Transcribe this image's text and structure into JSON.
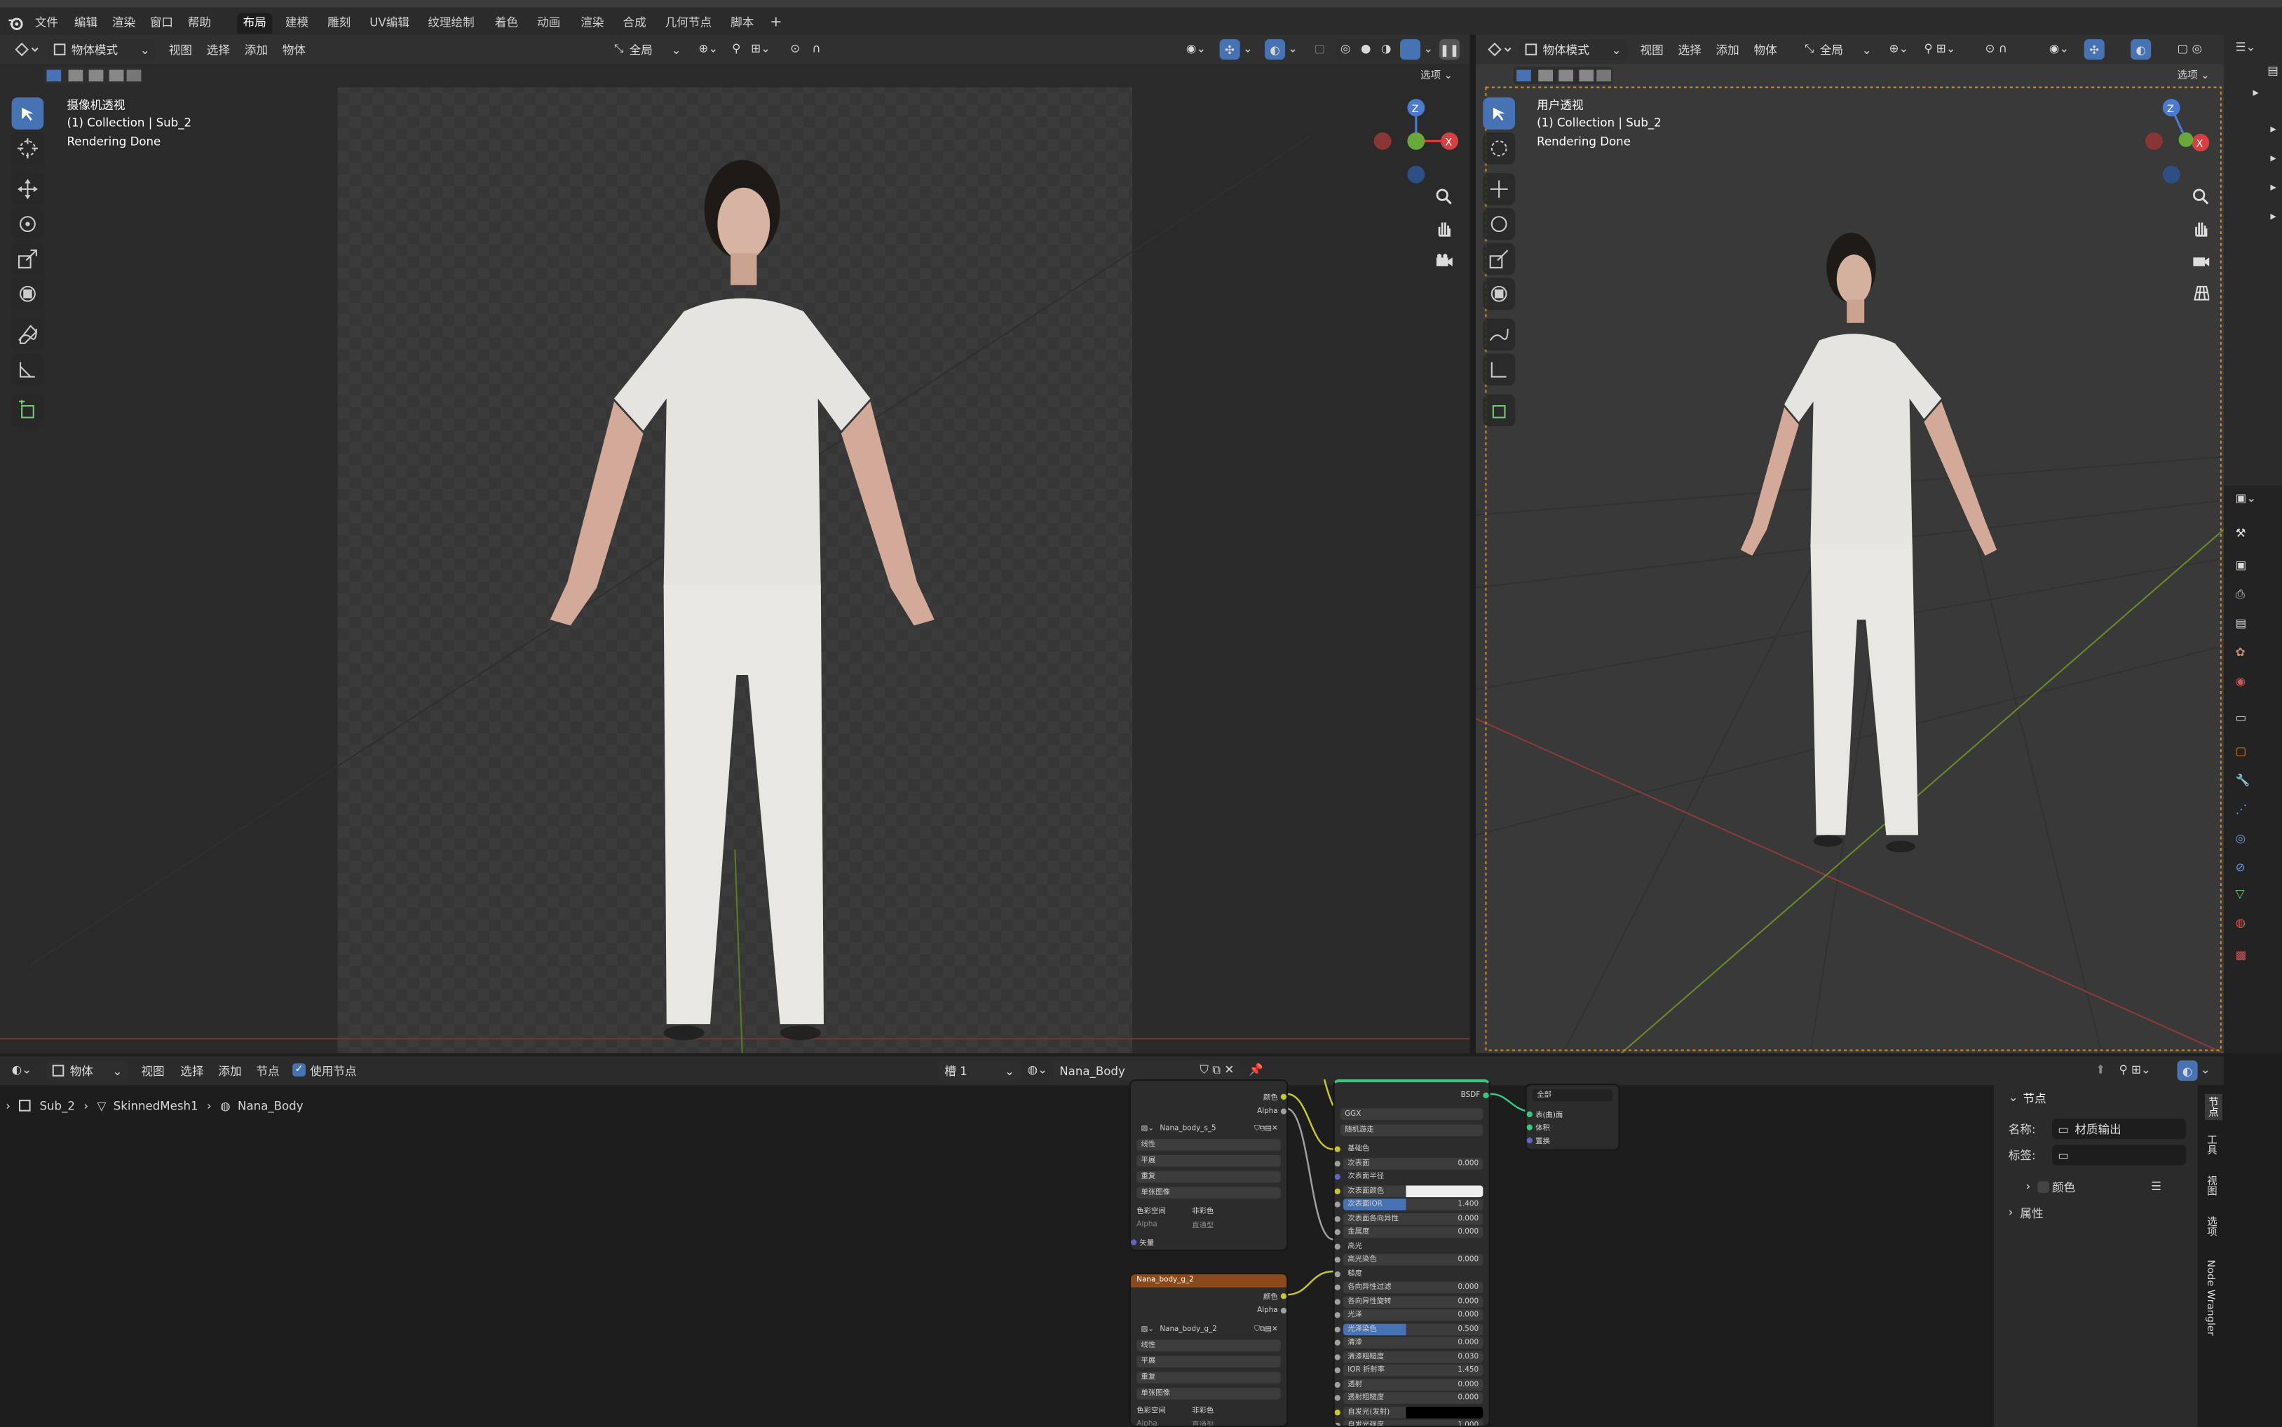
{
  "menu": {
    "file": "文件",
    "edit": "编辑",
    "render": "渲染",
    "window": "窗口",
    "help": "帮助"
  },
  "workspaces": [
    "布局",
    "建模",
    "雕刻",
    "UV编辑",
    "纹理绘制",
    "着色",
    "动画",
    "渲染",
    "合成",
    "几何节点",
    "脚本"
  ],
  "add_workspace": "+",
  "left_viewport": {
    "mode": "物体模式",
    "menus": [
      "视图",
      "选择",
      "添加",
      "物体"
    ],
    "transform": "全局",
    "options": "选项",
    "view_name": "摄像机透视",
    "collection": "(1) Collection | Sub_2",
    "status": "Rendering Done"
  },
  "right_viewport": {
    "mode": "物体模式",
    "menus": [
      "视图",
      "选择",
      "添加",
      "物体"
    ],
    "transform": "全局",
    "options": "选项",
    "view_name": "用户透视",
    "collection": "(1) Collection | Sub_2",
    "status": "Rendering Done"
  },
  "gizmo": {
    "z": "Z",
    "x": "X"
  },
  "node_editor": {
    "type": "物体",
    "menus": [
      "视图",
      "选择",
      "添加",
      "节点"
    ],
    "use_nodes_label": "使用节点",
    "use_nodes": true,
    "slot": "槽 1",
    "material": "Nana_Body",
    "breadcrumb": [
      "Sub_2",
      "SkinnedMesh1",
      "Nana_Body"
    ]
  },
  "nodes": {
    "image1": {
      "out_color": "颜色",
      "out_alpha": "Alpha",
      "image": "Nana_body_s_5",
      "rows": [
        "线性",
        "平展",
        "重复",
        "单张图像"
      ],
      "colorspace_label": "色彩空间",
      "colorspace": "非彩色",
      "alpha_label": "Alpha",
      "alpha_mode": "直通型",
      "vector": "矢量"
    },
    "image2": {
      "title": "Nana_body_g_2",
      "out_color": "颜色",
      "out_alpha": "Alpha",
      "image": "Nana_body_g_2",
      "rows": [
        "线性",
        "平展",
        "重复",
        "单张图像"
      ],
      "colorspace_label": "色彩空间",
      "colorspace": "非彩色",
      "alpha_label": "Alpha",
      "alpha_mode": "直通型"
    },
    "bsdf": {
      "title": "BSDF",
      "dist": "GGX",
      "subsurface_method": "随机游走",
      "rows": [
        {
          "label": "基础色",
          "value": ""
        },
        {
          "label": "次表面",
          "value": "0.000"
        },
        {
          "label": "次表面半径",
          "value": ""
        },
        {
          "label": "次表面颜色",
          "value": ""
        },
        {
          "label": "次表面IOR",
          "value": "1.400"
        },
        {
          "label": "次表面各向异性",
          "value": "0.000"
        },
        {
          "label": "金属度",
          "value": "0.000"
        },
        {
          "label": "高光",
          "value": ""
        },
        {
          "label": "高光染色",
          "value": "0.000"
        },
        {
          "label": "糙度",
          "value": ""
        },
        {
          "label": "各向异性过滤",
          "value": "0.000"
        },
        {
          "label": "各向异性旋转",
          "value": "0.000"
        },
        {
          "label": "光泽",
          "value": "0.000"
        },
        {
          "label": "光泽染色",
          "value": "0.500"
        },
        {
          "label": "清漆",
          "value": "0.000"
        },
        {
          "label": "清漆粗糙度",
          "value": "0.030"
        },
        {
          "label": "IOR 折射率",
          "value": "1.450"
        },
        {
          "label": "透射",
          "value": "0.000"
        },
        {
          "label": "透射粗糙度",
          "value": "0.000"
        },
        {
          "label": "自发光(发射)",
          "value": ""
        },
        {
          "label": "自发光强度",
          "value": "1.000"
        }
      ]
    },
    "output": {
      "target": "全部",
      "rows": [
        "表(曲)面",
        "体积",
        "置换"
      ]
    }
  },
  "sidebar": {
    "section": "节点",
    "name_label": "名称:",
    "name_value": "材质输出",
    "label_label": "标签:",
    "color_label": "颜色",
    "props_label": "属性",
    "tabs": [
      "节点",
      "工具",
      "视图",
      "选项",
      "Node Wrangler"
    ]
  }
}
